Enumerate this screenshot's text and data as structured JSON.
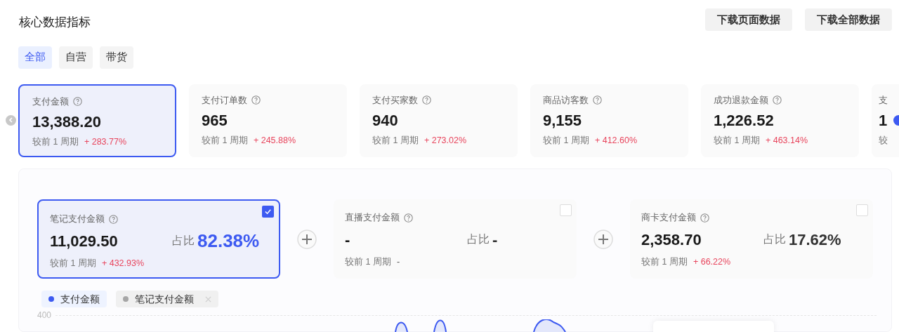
{
  "title": "核心数据指标",
  "buttons": [
    "下载页面数据",
    "下载全部数据"
  ],
  "tabs": [
    {
      "label": "全部",
      "selected": true
    },
    {
      "label": "自营",
      "selected": false
    },
    {
      "label": "带货",
      "selected": false
    }
  ],
  "metrics": [
    {
      "label": "支付金额",
      "help": true,
      "value": "13,388.20",
      "compare_label": "较前 1 周期",
      "change": "+ 283.77%",
      "selected": true
    },
    {
      "label": "支付订单数",
      "help": true,
      "value": "965",
      "compare_label": "较前 1 周期",
      "change": "+ 245.88%",
      "selected": false
    },
    {
      "label": "支付买家数",
      "help": true,
      "value": "940",
      "compare_label": "较前 1 周期",
      "change": "+ 273.02%",
      "selected": false
    },
    {
      "label": "商品访客数",
      "help": true,
      "value": "9,155",
      "compare_label": "较前 1 周期",
      "change": "+ 412.60%",
      "selected": false
    },
    {
      "label": "成功退款金额",
      "help": true,
      "value": "1,226.52",
      "compare_label": "较前 1 周期",
      "change": "+ 463.14%",
      "selected": false
    },
    {
      "label": "支",
      "help": false,
      "value": "1",
      "compare_label": "较",
      "selected": false
    }
  ],
  "sub_metrics": [
    {
      "label": "笔记支付金额",
      "value": "11,029.50",
      "share_label": "占比",
      "share": "82.38%",
      "compare_label": "较前 1 周期",
      "change": "+ 432.93%",
      "rising": true,
      "checked": true
    },
    {
      "label": "直播支付金额",
      "value": "-",
      "share_label": "占比",
      "share": "-",
      "compare_label": "较前 1 周期",
      "change": "-",
      "rising": false,
      "checked": false
    },
    {
      "label": "商卡支付金额",
      "value": "2,358.70",
      "share_label": "占比",
      "share": "17.62%",
      "compare_label": "较前 1 周期",
      "change": "+ 66.22%",
      "rising": true,
      "checked": false
    }
  ],
  "legend": [
    {
      "label": "支付金额",
      "color": "#3d5af1",
      "removable": false
    },
    {
      "label": "笔记支付金额",
      "color": "#a6a6a6",
      "removable": true
    }
  ],
  "chart": {
    "y_tick": "400"
  }
}
